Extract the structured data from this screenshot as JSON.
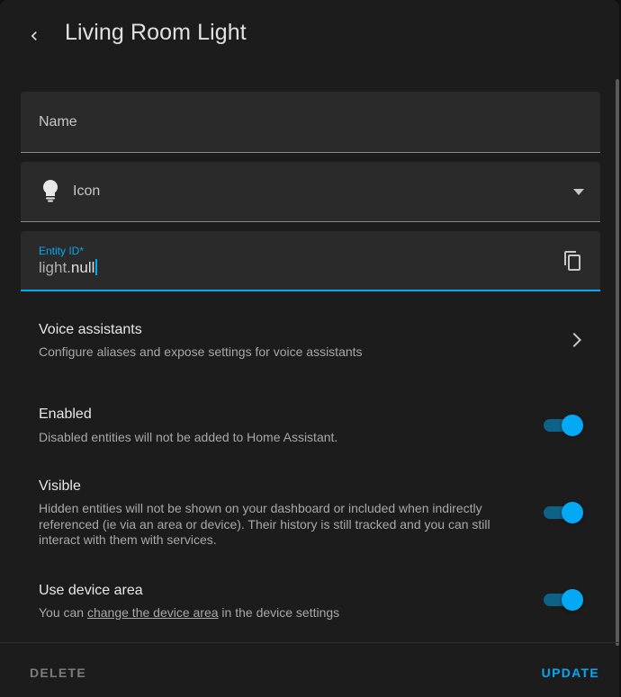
{
  "header": {
    "title": "Living Room Light"
  },
  "fields": {
    "name": {
      "placeholder": "Name"
    },
    "icon": {
      "placeholder": "Icon"
    },
    "entity_id": {
      "label": "Entity ID*",
      "prefix": "light.",
      "value": "null"
    }
  },
  "voice": {
    "title": "Voice assistants",
    "description": "Configure aliases and expose settings for voice assistants"
  },
  "enabled": {
    "title": "Enabled",
    "description": "Disabled entities will not be added to Home Assistant.",
    "on": true
  },
  "visible": {
    "title": "Visible",
    "description": "Hidden entities will not be shown on your dashboard or included when indirectly referenced (ie via an area or device). Their history is still tracked and you can still interact with them with services.",
    "on": true
  },
  "device_area": {
    "title": "Use device area",
    "desc_before": "You can ",
    "desc_link": "change the device area",
    "desc_after": " in the device settings",
    "on": true
  },
  "footer": {
    "delete_label": "DELETE",
    "update_label": "UPDATE"
  },
  "colors": {
    "accent": "#03a9f4",
    "background": "#1c1c1c",
    "field": "#2a2a2a"
  },
  "icons": [
    "chevron-left-icon",
    "lightbulb-icon",
    "caret-down-icon",
    "copy-icon",
    "chevron-right-icon"
  ]
}
